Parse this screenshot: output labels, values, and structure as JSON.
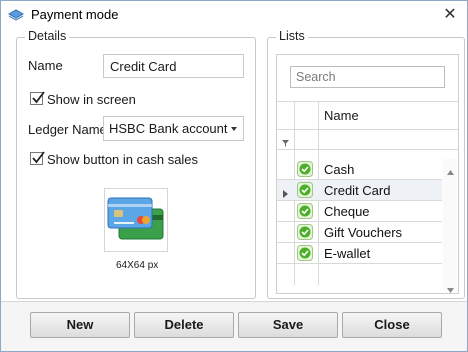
{
  "window": {
    "title": "Payment mode",
    "close_glyph": "✕"
  },
  "details": {
    "legend": "Details",
    "name_label": "Name",
    "name_value": "Credit Card",
    "show_in_screen_label": "Show in screen",
    "show_in_screen_checked": true,
    "ledger_label": "Ledger Name",
    "ledger_value": "HSBC Bank account",
    "show_button_label": "Show button in cash sales",
    "show_button_checked": true,
    "image_caption": "64X64 px"
  },
  "lists": {
    "legend": "Lists",
    "search_placeholder": "Search",
    "column_name": "Name",
    "rows": [
      {
        "name": "Cash",
        "selected": false
      },
      {
        "name": "Credit Card",
        "selected": true
      },
      {
        "name": "Cheque",
        "selected": false
      },
      {
        "name": "Gift Vouchers",
        "selected": false
      },
      {
        "name": "E-wallet",
        "selected": false
      }
    ]
  },
  "buttons": {
    "new": "New",
    "delete": "Delete",
    "save": "Save",
    "close": "Close"
  },
  "colors": {
    "accent_green": "#4caf28",
    "title_icon": "#3a7bd5",
    "window_border": "#8fa8c8"
  }
}
